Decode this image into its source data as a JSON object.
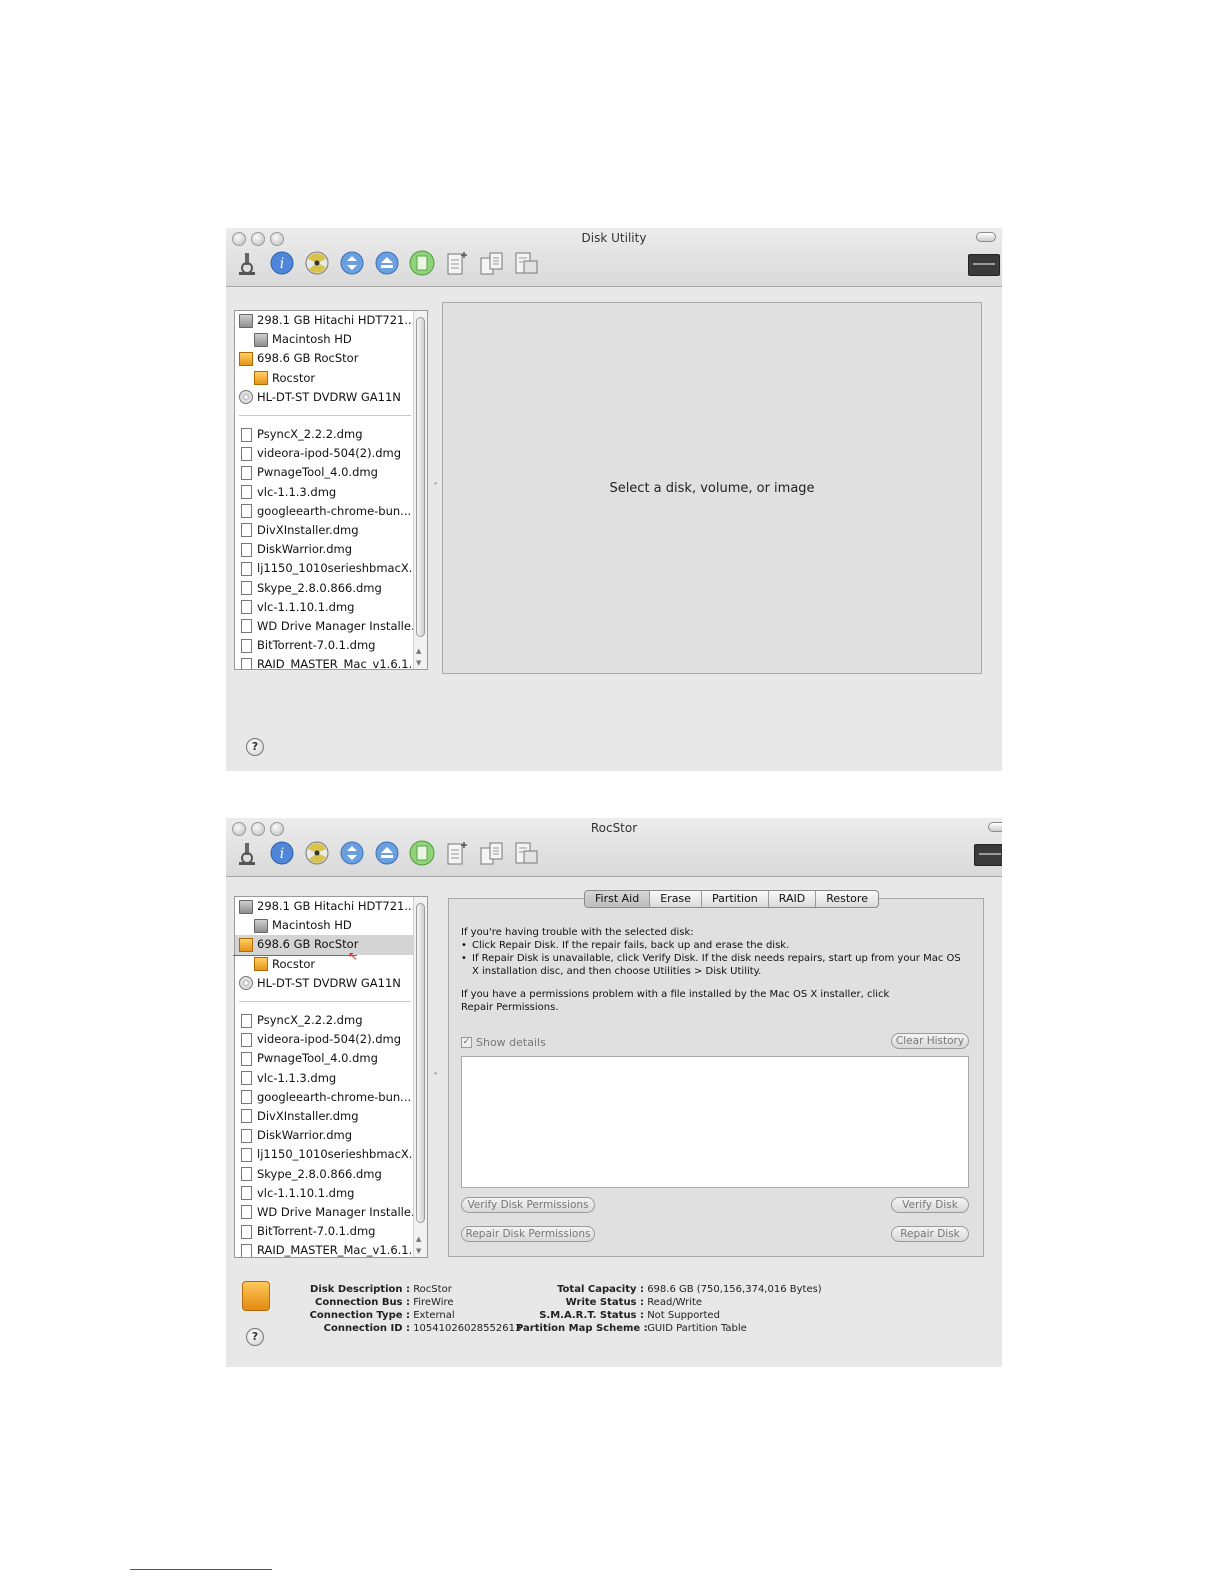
{
  "windows": [
    {
      "title": "Disk Utility",
      "placeholder": "Select a disk, volume, or image"
    },
    {
      "title": "RocStor",
      "tabs": [
        "First Aid",
        "Erase",
        "Partition",
        "RAID",
        "Restore"
      ],
      "active_tab": "First Aid",
      "first_aid": {
        "intro": "If you're having trouble with the selected disk:",
        "bullet1": "Click Repair Disk. If the repair fails, back up and erase the disk.",
        "bullet2": "If Repair Disk is unavailable, click Verify Disk. If the disk needs repairs, start up from your Mac OS X installation disc, and then choose Utilities > Disk Utility.",
        "permissions": "If you have a permissions problem with a file installed by the Mac OS X installer, click Repair Permissions.",
        "show_details": "Show details",
        "show_details_checked": true,
        "clear_history": "Clear History",
        "verify_permissions": "Verify Disk Permissions",
        "repair_permissions": "Repair Disk Permissions",
        "verify_disk": "Verify Disk",
        "repair_disk": "Repair Disk"
      },
      "info": {
        "left": [
          {
            "k": "Disk Description :",
            "v": "RocStor"
          },
          {
            "k": "Connection Bus :",
            "v": "FireWire"
          },
          {
            "k": "Connection Type :",
            "v": "External"
          },
          {
            "k": "Connection ID :",
            "v": "10541026028552613"
          }
        ],
        "right": [
          {
            "k": "Total Capacity :",
            "v": "698.6 GB (750,156,374,016 Bytes)"
          },
          {
            "k": "Write Status :",
            "v": "Read/Write"
          },
          {
            "k": "S.M.A.R.T. Status :",
            "v": "Not Supported"
          },
          {
            "k": "Partition Map Scheme :",
            "v": "GUID Partition Table"
          }
        ]
      }
    }
  ],
  "toolbar": [
    "verify-icon",
    "info-icon",
    "burn-icon",
    "mount-icon",
    "eject-icon",
    "enable-journaling-icon",
    "new-image-icon",
    "convert-icon",
    "resize-image-icon"
  ],
  "log_label": "Log",
  "sidebar": {
    "devices": [
      {
        "label": "298.1 GB Hitachi HDT721...",
        "icon": "hdd",
        "level": 0
      },
      {
        "label": "Macintosh HD",
        "icon": "hdd",
        "level": 1
      },
      {
        "label": "698.6 GB RocStor",
        "icon": "ext",
        "level": 0
      },
      {
        "label": "Rocstor",
        "icon": "ext",
        "level": 1
      },
      {
        "label": "HL-DT-ST DVDRW GA11N",
        "icon": "opt",
        "level": 0
      }
    ],
    "images": [
      "PsyncX_2.2.2.dmg",
      "videora-ipod-504(2).dmg",
      "PwnageTool_4.0.dmg",
      "vlc-1.1.3.dmg",
      "googleearth-chrome-bun...",
      "DivXInstaller.dmg",
      "DiskWarrior.dmg",
      "lj1150_1010serieshbmacX...",
      "Skype_2.8.0.866.dmg",
      "vlc-1.1.10.1.dmg",
      "WD Drive Manager Installe...",
      "BitTorrent-7.0.1.dmg",
      "RAID_MASTER_Mac_v1.6.1..."
    ],
    "selected_in_window2": "698.6 GB RocStor"
  },
  "colors": {
    "accent_ext": "#f0a830",
    "selection": "#d4d4d4",
    "annotation": "#e33333"
  }
}
